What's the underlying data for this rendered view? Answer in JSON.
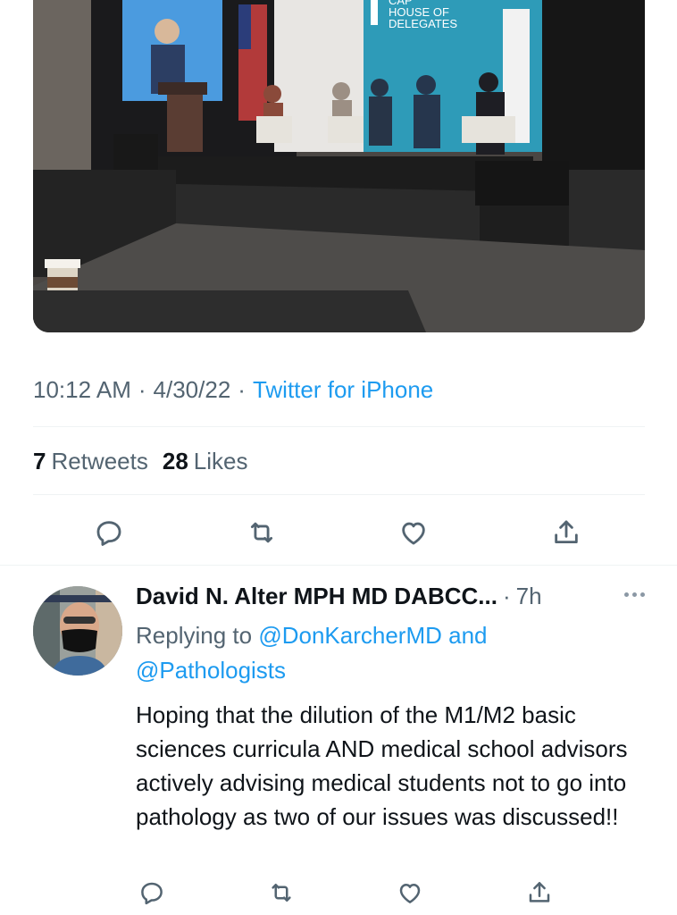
{
  "photo": {
    "alt_icon": "conference-panel-photo",
    "banner_line1": "CAP",
    "banner_line2": "HOUSE OF",
    "banner_line3": "DELEGATES"
  },
  "tweet_meta": {
    "time": "10:12 AM",
    "date": "4/30/22",
    "separator": "·",
    "source": "Twitter for iPhone"
  },
  "stats": {
    "retweets_count": "7",
    "retweets_label": "Retweets",
    "likes_count": "28",
    "likes_label": "Likes"
  },
  "actions": [
    "reply-icon",
    "retweet-icon",
    "like-icon",
    "share-icon"
  ],
  "reply": {
    "author_name": "David N. Alter MPH MD DABCC...",
    "separator": "·",
    "time_ago": "7h",
    "replying_prefix": "Replying to",
    "mention_1": "@DonKarcherMD",
    "and_word": "and",
    "mention_2": "@Pathologists",
    "text": "Hoping that the dilution of the M1/M2 basic sciences curricula AND medical school advisors actively advising medical students not to go into pathology as two of our issues was discussed!!"
  },
  "colors": {
    "accent": "#1d9bf0",
    "secondary_text": "#536471",
    "primary_text": "#0f1419",
    "divider": "#eff3f4"
  }
}
